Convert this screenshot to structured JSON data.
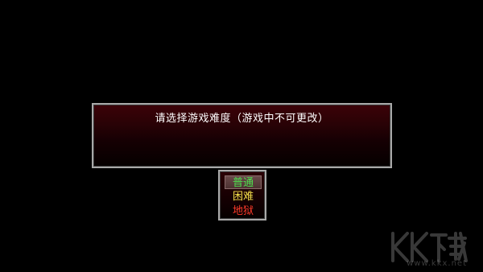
{
  "message": {
    "text": "请选择游戏难度（游戏中不可更改）"
  },
  "difficulty_menu": {
    "options": [
      {
        "label": "普通",
        "color": "#4ee04e",
        "selected": true
      },
      {
        "label": "困难",
        "color": "#f4e04a",
        "selected": false
      },
      {
        "label": "地狱",
        "color": "#ff3a2a",
        "selected": false
      }
    ]
  },
  "watermark": {
    "logo_text": "KK下载",
    "url": "www.kkx.net"
  },
  "colors": {
    "background": "#000000",
    "window_border": "#a9a9a9",
    "window_top": "#3c0208"
  }
}
